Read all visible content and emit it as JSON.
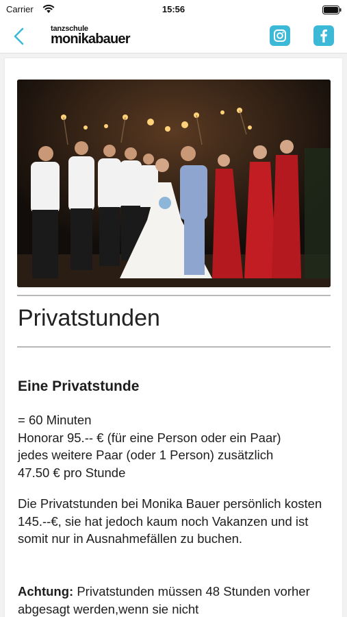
{
  "status_bar": {
    "carrier": "Carrier",
    "time": "15:56"
  },
  "nav": {
    "logo_line1": "tanzschule",
    "logo_line2": "monikabauer",
    "accent_color": "#3bb9d6",
    "icons": [
      "chevron-left-icon",
      "instagram-icon",
      "facebook-icon"
    ]
  },
  "content": {
    "title": "Privatstunden",
    "section_heading": "Eine Privatstunde",
    "details": [
      "= 60 Minuten",
      "Honorar 95.-- € (für eine Person oder ein Paar)",
      "jedes weitere Paar (oder 1 Person) zusätzlich",
      "47.50 € pro Stunde"
    ],
    "paragraph": "Die Privatstunden bei Monika Bauer persönlich kosten 145.--€, sie hat jedoch kaum noch Vakanzen und ist somit nur in Ausnahmefällen zu buchen.",
    "notice_label": "Achtung:",
    "notice_text": "Privatstunden müssen 48 Stunden vorher abgesagt werden,wenn sie nicht"
  }
}
